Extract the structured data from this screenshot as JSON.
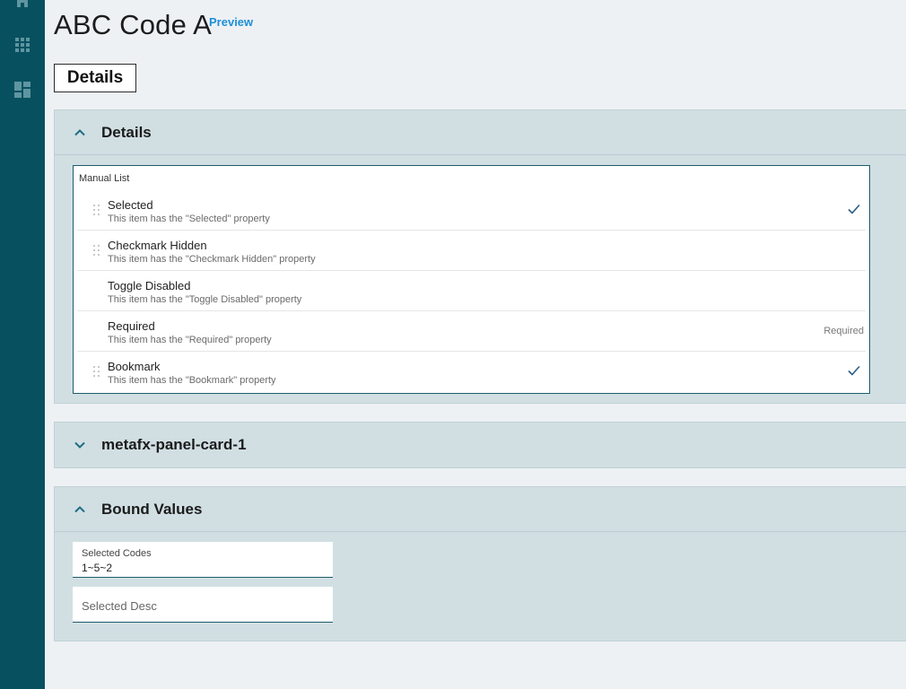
{
  "page": {
    "title": "ABC Code A",
    "preview_link": "Preview",
    "tab_label": "Details"
  },
  "sidebar": {
    "icons": [
      "home-icon",
      "apps-grid-icon",
      "dashboard-icon"
    ]
  },
  "panels": {
    "details": {
      "title": "Details",
      "expanded": true,
      "manual_list": {
        "label": "Manual List",
        "items": [
          {
            "title": "Selected",
            "subtitle": "This item has the \"Selected\" property",
            "checked": true,
            "drag_handle": true,
            "tag": ""
          },
          {
            "title": "Checkmark Hidden",
            "subtitle": "This item has the \"Checkmark Hidden\" property",
            "checked": false,
            "drag_handle": true,
            "tag": ""
          },
          {
            "title": "Toggle Disabled",
            "subtitle": "This item has the \"Toggle Disabled\" property",
            "checked": false,
            "drag_handle": false,
            "tag": ""
          },
          {
            "title": "Required",
            "subtitle": "This item has the \"Required\" property",
            "checked": false,
            "drag_handle": false,
            "tag": "Required"
          },
          {
            "title": "Bookmark",
            "subtitle": "This item has the \"Bookmark\" property",
            "checked": true,
            "drag_handle": true,
            "tag": ""
          }
        ]
      }
    },
    "card": {
      "title": "metafx-panel-card-1",
      "expanded": false
    },
    "bound_values": {
      "title": "Bound Values",
      "expanded": true,
      "selected_codes": {
        "label": "Selected Codes",
        "value": "1~5~2"
      },
      "selected_desc": {
        "placeholder": "Selected Desc",
        "value": ""
      }
    }
  },
  "colors": {
    "sidebar": "#07505f",
    "accent": "#1d5c6c",
    "link": "#1d8fd6",
    "panel_bg": "#d1dfe3",
    "page_bg": "#eef1f4"
  }
}
